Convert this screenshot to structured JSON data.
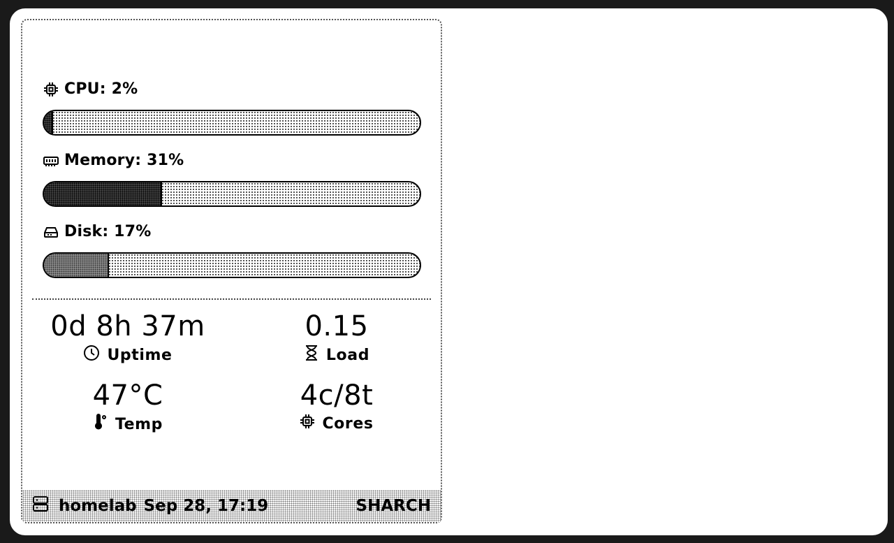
{
  "metrics": {
    "cpu": {
      "label": "CPU: 2%",
      "percent": 2,
      "icon": "cpu-icon"
    },
    "memory": {
      "label": "Memory: 31%",
      "percent": 31,
      "icon": "memory-icon"
    },
    "disk": {
      "label": "Disk: 17%",
      "percent": 17,
      "icon": "disk-icon"
    }
  },
  "stats": {
    "uptime": {
      "value": "0d 8h 37m",
      "label": "Uptime",
      "icon": "clock-icon"
    },
    "load": {
      "value": "0.15",
      "label": "Load",
      "icon": "hourglass-icon"
    },
    "temp": {
      "value": "47°C",
      "label": "Temp",
      "icon": "thermometer-icon"
    },
    "cores": {
      "value": "4c/8t",
      "label": "Cores",
      "icon": "cpu-icon"
    }
  },
  "footer": {
    "hostname": "homelab",
    "datetime": "Sep 28, 17:19",
    "brand": "SHARCH",
    "icon": "server-icon"
  }
}
